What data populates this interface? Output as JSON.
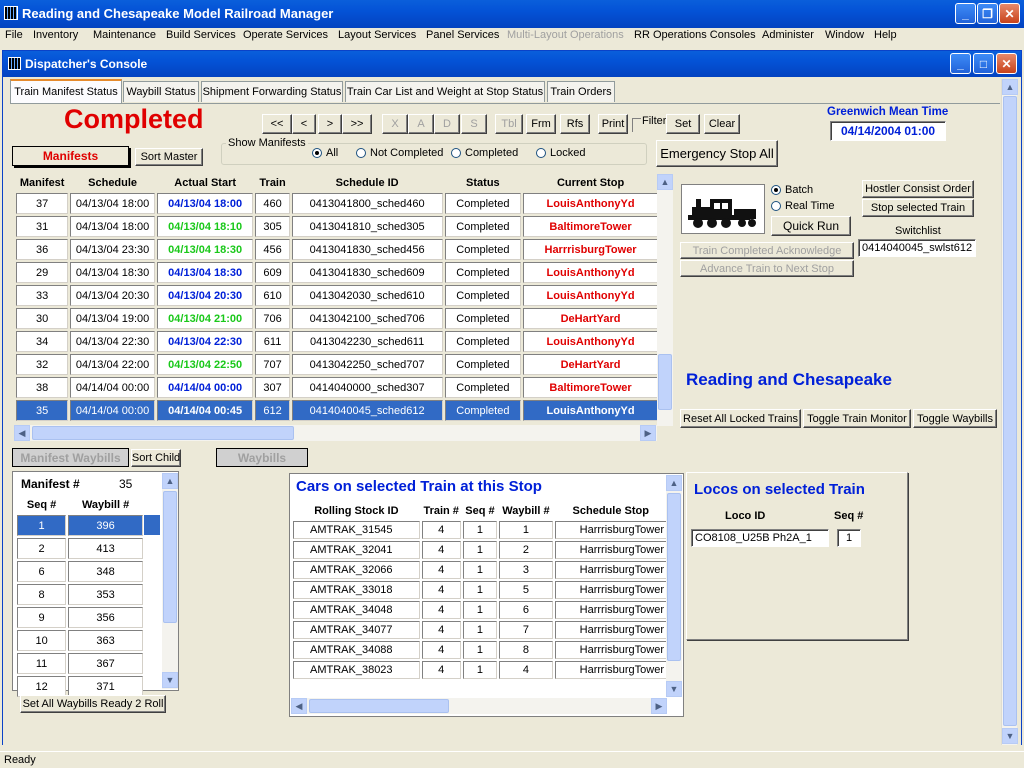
{
  "app": {
    "title": "Reading and Chesapeake Model Railroad Manager"
  },
  "menu": [
    "File",
    "Inventory",
    "Maintenance",
    "Build Services",
    "Operate Services",
    "Layout Services",
    "Panel Services",
    "Multi-Layout Operations",
    "RR Operations Consoles",
    "Administer",
    "Window",
    "Help"
  ],
  "window": {
    "title": "Dispatcher's Console"
  },
  "tabs": [
    "Train Manifest Status",
    "Waybill Status",
    "Shipment Forwarding Status",
    "Train Car List and Weight at Stop Status",
    "Train Orders"
  ],
  "status_heading": "Completed",
  "nav": {
    "first": "<<",
    "prev": "<",
    "next": ">",
    "last": ">>",
    "x": "X",
    "a": "A",
    "d": "D",
    "s": "S",
    "tbl": "Tbl",
    "frm": "Frm",
    "rfs": "Rfs",
    "print": "Print",
    "filter": "Filter",
    "set": "Set",
    "clear": "Clear"
  },
  "gmt": {
    "label": "Greenwich Mean Time",
    "value": "04/14/2004 01:00"
  },
  "manifests_label": "Manifests",
  "sort_master": "Sort Master",
  "show_manifests": {
    "label": "Show Manifests",
    "options": [
      "All",
      "Not Completed",
      "Completed",
      "Locked"
    ],
    "selected": "All"
  },
  "emergency_stop": "Emergency Stop All",
  "manifest_table": {
    "headers": [
      "Manifest",
      "Schedule",
      "Actual Start",
      "Train",
      "Schedule ID",
      "Status",
      "Current Stop"
    ],
    "rows": [
      {
        "manifest": "37",
        "schedule": "04/13/04 18:00",
        "actual": "04/13/04 18:00",
        "actual_color": "blue",
        "train": "460",
        "sched_id": "0413041800_sched460",
        "status": "Completed",
        "stop": "LouisAnthonyYd"
      },
      {
        "manifest": "31",
        "schedule": "04/13/04 18:00",
        "actual": "04/13/04 18:10",
        "actual_color": "green",
        "train": "305",
        "sched_id": "0413041810_sched305",
        "status": "Completed",
        "stop": "BaltimoreTower"
      },
      {
        "manifest": "36",
        "schedule": "04/13/04 23:30",
        "actual": "04/13/04 18:30",
        "actual_color": "green",
        "train": "456",
        "sched_id": "0413041830_sched456",
        "status": "Completed",
        "stop": "HarrrisburgTower"
      },
      {
        "manifest": "29",
        "schedule": "04/13/04 18:30",
        "actual": "04/13/04 18:30",
        "actual_color": "blue",
        "train": "609",
        "sched_id": "0413041830_sched609",
        "status": "Completed",
        "stop": "LouisAnthonyYd"
      },
      {
        "manifest": "33",
        "schedule": "04/13/04 20:30",
        "actual": "04/13/04 20:30",
        "actual_color": "blue",
        "train": "610",
        "sched_id": "0413042030_sched610",
        "status": "Completed",
        "stop": "LouisAnthonyYd"
      },
      {
        "manifest": "30",
        "schedule": "04/13/04 19:00",
        "actual": "04/13/04 21:00",
        "actual_color": "green",
        "train": "706",
        "sched_id": "0413042100_sched706",
        "status": "Completed",
        "stop": "DeHartYard"
      },
      {
        "manifest": "34",
        "schedule": "04/13/04 22:30",
        "actual": "04/13/04 22:30",
        "actual_color": "blue",
        "train": "611",
        "sched_id": "0413042230_sched611",
        "status": "Completed",
        "stop": "LouisAnthonyYd"
      },
      {
        "manifest": "32",
        "schedule": "04/13/04 22:00",
        "actual": "04/13/04 22:50",
        "actual_color": "green",
        "train": "707",
        "sched_id": "0413042250_sched707",
        "status": "Completed",
        "stop": "DeHartYard"
      },
      {
        "manifest": "38",
        "schedule": "04/14/04 00:00",
        "actual": "04/14/04 00:00",
        "actual_color": "blue",
        "train": "307",
        "sched_id": "0414040000_sched307",
        "status": "Completed",
        "stop": "BaltimoreTower"
      },
      {
        "manifest": "35",
        "schedule": "04/14/04 00:00",
        "actual": "04/14/04 00:45",
        "actual_color": "blue",
        "train": "612",
        "sched_id": "0414040045_sched612",
        "status": "Completed",
        "stop": "LouisAnthonyYd",
        "selected": true
      }
    ]
  },
  "controls": {
    "batch": "Batch",
    "realtime": "Real Time",
    "mode": "Batch",
    "quick_run": "Quick Run",
    "hostler": "Hostler Consist Order",
    "stop_train": "Stop selected Train",
    "switchlist_label": "Switchlist",
    "switchlist_value": "0414040045_swlst612",
    "train_completed": "Train Completed Acknowledge",
    "advance_train": "Advance Train to Next Stop"
  },
  "railroad_name": "Reading and Chesapeake",
  "bottom_buttons": {
    "reset": "Reset All Locked Trains",
    "toggle_monitor": "Toggle Train Monitor",
    "toggle_waybills": "Toggle Waybills"
  },
  "manifest_waybills": {
    "label": "Manifest Waybills",
    "sort_child": "Sort Child",
    "waybills_label": "Waybills",
    "manifest_label": "Manifest #",
    "manifest_value": "35",
    "headers": [
      "Seq #",
      "Waybill #"
    ],
    "rows": [
      [
        "1",
        "396"
      ],
      [
        "2",
        "413"
      ],
      [
        "6",
        "348"
      ],
      [
        "8",
        "353"
      ],
      [
        "9",
        "356"
      ],
      [
        "10",
        "363"
      ],
      [
        "11",
        "367"
      ],
      [
        "12",
        "371"
      ]
    ],
    "set_all": "Set All Waybills Ready 2 Roll"
  },
  "cars": {
    "title": "Cars on selected Train at this Stop",
    "headers": [
      "Rolling Stock ID",
      "Train #",
      "Seq #",
      "Waybill #",
      "Schedule Stop"
    ],
    "rows": [
      [
        "AMTRAK_31545",
        "4",
        "1",
        "1",
        "HarrrisburgTower"
      ],
      [
        "AMTRAK_32041",
        "4",
        "1",
        "2",
        "HarrrisburgTower"
      ],
      [
        "AMTRAK_32066",
        "4",
        "1",
        "3",
        "HarrrisburgTower"
      ],
      [
        "AMTRAK_33018",
        "4",
        "1",
        "5",
        "HarrrisburgTower"
      ],
      [
        "AMTRAK_34048",
        "4",
        "1",
        "6",
        "HarrrisburgTower"
      ],
      [
        "AMTRAK_34077",
        "4",
        "1",
        "7",
        "HarrrisburgTower"
      ],
      [
        "AMTRAK_34088",
        "4",
        "1",
        "8",
        "HarrrisburgTower"
      ],
      [
        "AMTRAK_38023",
        "4",
        "1",
        "4",
        "HarrrisburgTower"
      ]
    ]
  },
  "locos": {
    "title": "Locos on selected Train",
    "headers": [
      "Loco ID",
      "Seq #"
    ],
    "rows": [
      [
        "CO8108_U25B Ph2A_1",
        "1"
      ]
    ]
  },
  "statusbar": "Ready",
  "colors": {
    "title_blue": "#0452d6",
    "red": "#e00000",
    "blue": "#0020d8",
    "green": "#1ac81a",
    "selection": "#316ac5"
  }
}
